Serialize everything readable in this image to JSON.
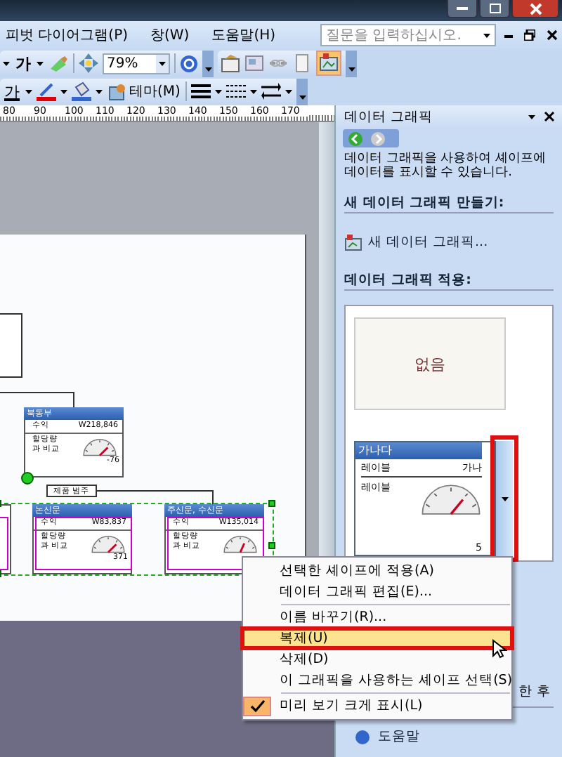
{
  "menu_bar": {
    "items": [
      "피벗 다이어그램(P)",
      "창(W)",
      "도움말(H)"
    ],
    "help_search": {
      "placeholder": "질문을 입력하십시오."
    }
  },
  "toolbar_1": {
    "font_label": "가",
    "zoom": "79%"
  },
  "toolbar_2": {
    "font_color_label": "가",
    "theme_button": "테마(M)"
  },
  "ruler": {
    "labels": [
      "80",
      "90",
      "100",
      "110",
      "120",
      "130",
      "140",
      "150",
      "160",
      "170"
    ]
  },
  "diagram": {
    "top_node": {
      "title": "북동부",
      "revenue_label": "수익",
      "revenue": "W218,846",
      "compare_label": "할당량과 비교",
      "reading": "-76"
    },
    "category_label": "제품 범주",
    "nodes": [
      {
        "title": "논신문",
        "revenue_label": "수익",
        "revenue": "W83,837",
        "compare_label": "할당량과 비교",
        "reading": "371"
      },
      {
        "title": "주신문, 수신문",
        "revenue_label": "수익",
        "revenue": "W135,014",
        "compare_label": "할당량과 비교"
      }
    ]
  },
  "task_pane": {
    "title": "데이터 그래픽",
    "description": "데이터 그래픽을 사용하여 셰이프에 데이터를 표시할 수 있습니다.",
    "new_section": "새 데이터 그래픽 만들기:",
    "new_link": "새 데이터 그래픽...",
    "apply_section": "데이터 그래픽 적용:",
    "gallery": [
      {
        "kind": "none",
        "label": "없음"
      },
      {
        "kind": "sample",
        "title": "가나다",
        "label_1": "레이블",
        "value_1": "가나",
        "label_2": "레이블",
        "reading": "5"
      }
    ],
    "footer_text": "한 후",
    "help_link": "도움말"
  },
  "context_menu": {
    "items": [
      {
        "label": "선택한 셰이프에 적용(A)",
        "selected": false,
        "checked": false
      },
      {
        "label": "데이터 그래픽 편집(E)...",
        "selected": false,
        "checked": false
      },
      {
        "kind": "separator"
      },
      {
        "label": "이름 바꾸기(R)...",
        "selected": false,
        "checked": false
      },
      {
        "label": "복제(U)",
        "selected": true,
        "checked": false
      },
      {
        "label": "삭제(D)",
        "selected": false,
        "checked": false
      },
      {
        "label": "이 그래픽을 사용하는 셰이프 선택(S)",
        "selected": false,
        "checked": false
      },
      {
        "kind": "separator"
      },
      {
        "label": "미리 보기 크게 표시(L)",
        "selected": false,
        "checked": true
      }
    ]
  }
}
